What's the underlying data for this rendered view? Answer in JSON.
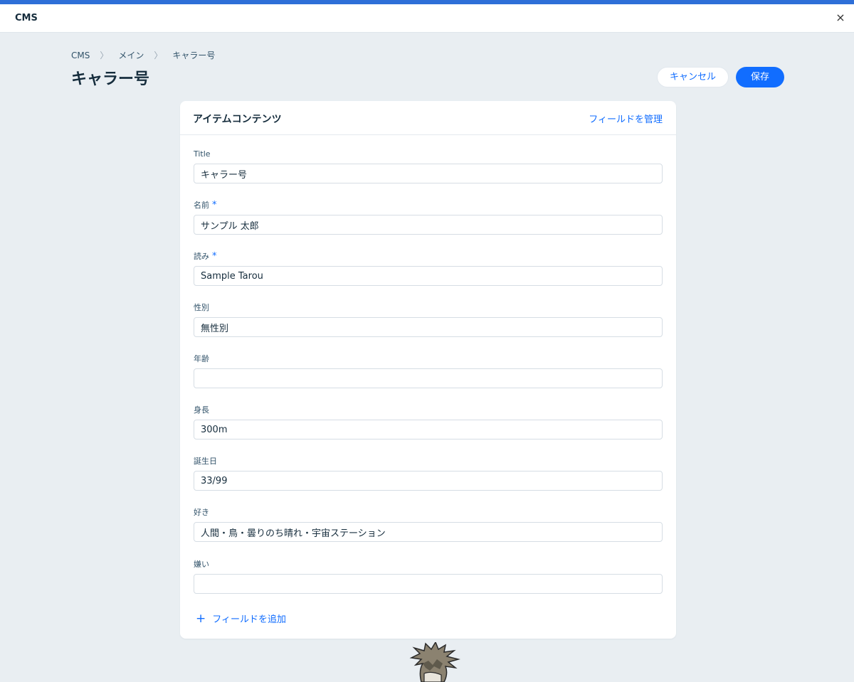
{
  "window": {
    "title": "CMS",
    "close_glyph": "×"
  },
  "breadcrumb": {
    "items": [
      "CMS",
      "メイン",
      "キャラー号"
    ],
    "separator": "〉"
  },
  "page": {
    "title": "キャラー号"
  },
  "actions": {
    "cancel_label": "キャンセル",
    "save_label": "保存"
  },
  "card": {
    "title": "アイテムコンテンツ",
    "manage_label": "フィールドを管理",
    "add_field_label": "フィールドを追加",
    "add_glyph": "+"
  },
  "fields": [
    {
      "label": "Title",
      "value": "キャラー号",
      "required": false
    },
    {
      "label": "名前",
      "value": "サンプル 太郎",
      "required": true
    },
    {
      "label": "読み",
      "value": "Sample Tarou",
      "required": true
    },
    {
      "label": "性別",
      "value": "無性別",
      "required": false
    },
    {
      "label": "年齢",
      "value": "",
      "required": false
    },
    {
      "label": "身長",
      "value": "300m",
      "required": false
    },
    {
      "label": "誕生日",
      "value": "33/99",
      "required": false
    },
    {
      "label": "好き",
      "value": "人間・鳥・曇りのち晴れ・宇宙ステーション",
      "required": false
    },
    {
      "label": "嫌い",
      "value": "",
      "required": false
    }
  ],
  "required_mark": "*",
  "colors": {
    "accent": "#116dff",
    "background": "#e9eef2",
    "top_strip": "#2e6fd8"
  }
}
